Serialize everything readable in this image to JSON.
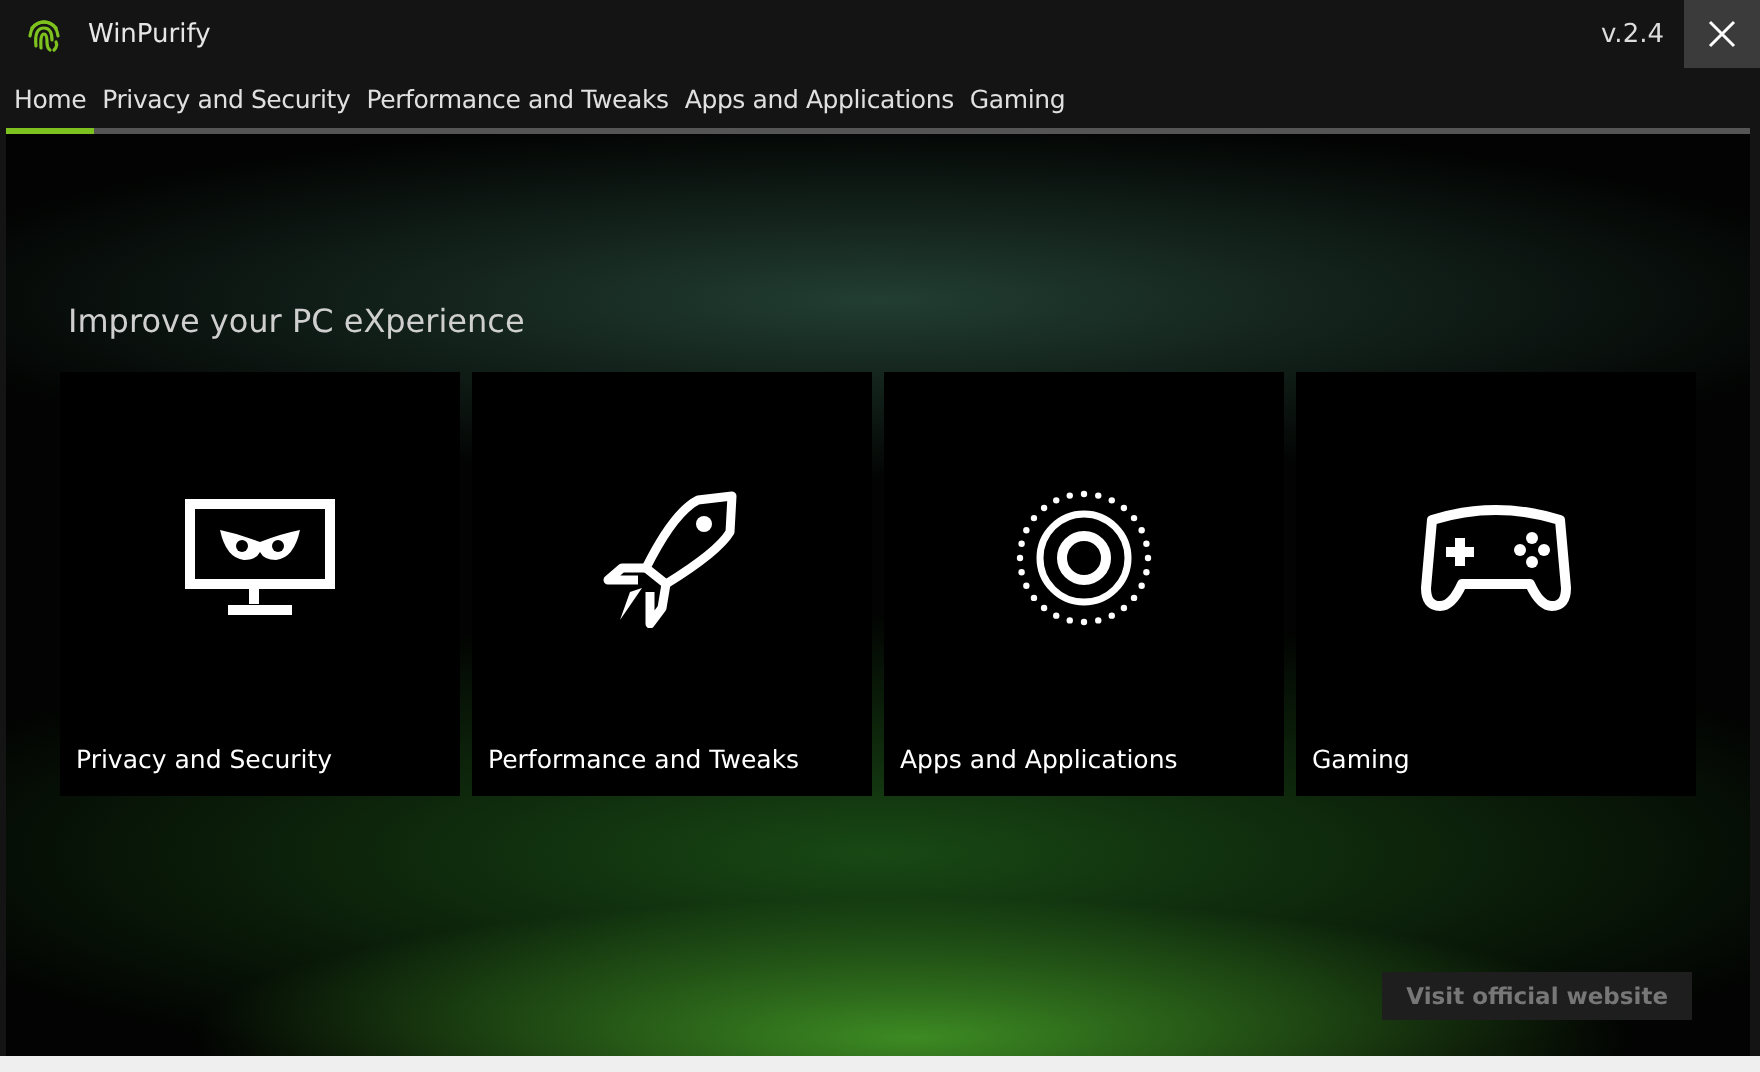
{
  "window": {
    "title": "WinPurify",
    "version": "v.2.4"
  },
  "tabs": [
    {
      "label": "Home",
      "selected": true
    },
    {
      "label": "Privacy and Security",
      "selected": false
    },
    {
      "label": "Performance and Tweaks",
      "selected": false
    },
    {
      "label": "Apps and Applications",
      "selected": false
    },
    {
      "label": "Gaming",
      "selected": false
    }
  ],
  "heading": "Improve your PC eXperience",
  "tiles": [
    {
      "kind": "monitor",
      "label": "Privacy and Security"
    },
    {
      "kind": "rocket",
      "label": "Performance and Tweaks"
    },
    {
      "kind": "target",
      "label": "Apps and Applications"
    },
    {
      "kind": "gamepad",
      "label": "Gaming"
    }
  ],
  "website_button": "Visit official website"
}
